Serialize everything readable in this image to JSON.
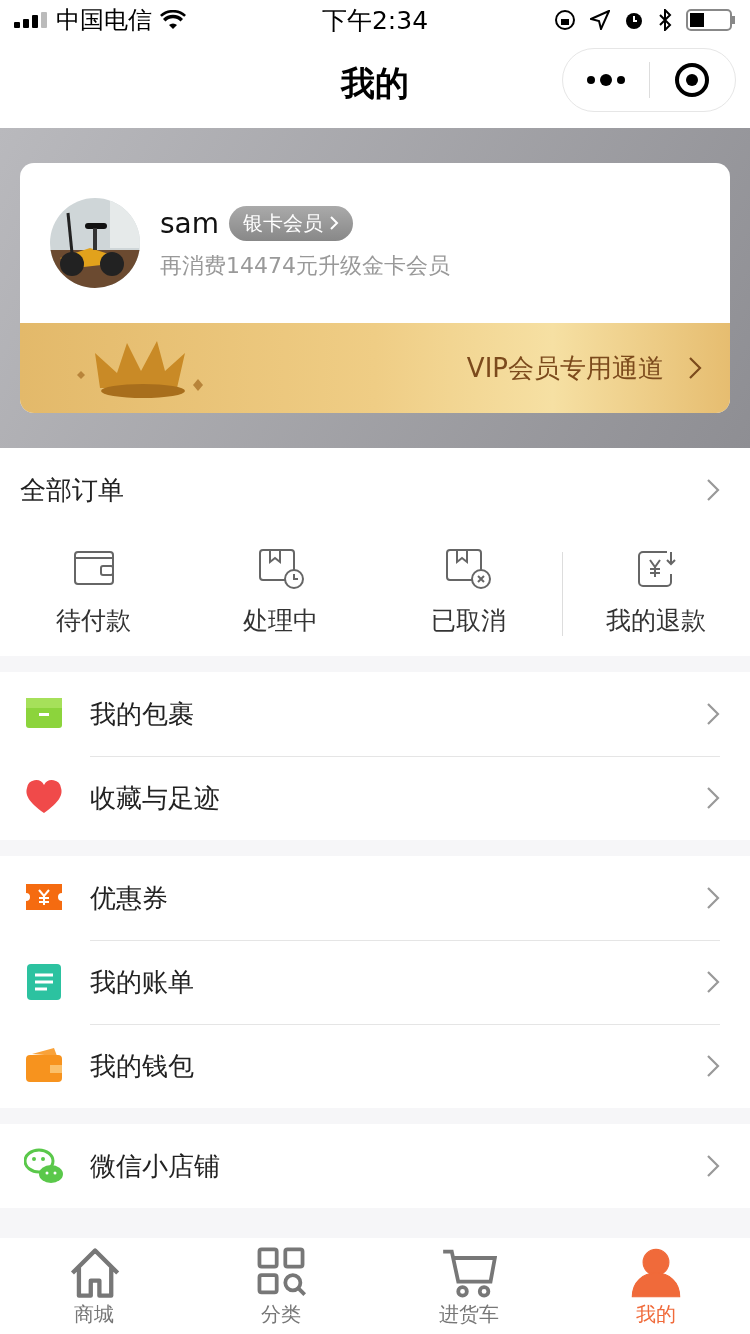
{
  "status_bar": {
    "carrier": "中国电信",
    "time": "下午2:34"
  },
  "nav": {
    "title": "我的"
  },
  "profile": {
    "name": "sam",
    "badge": "银卡会员",
    "subtitle": "再消费14474元升级金卡会员"
  },
  "vip_banner": {
    "label": "VIP会员专用通道"
  },
  "orders": {
    "title": "全部订单",
    "items": [
      {
        "label": "待付款",
        "kind": "wallet"
      },
      {
        "label": "处理中",
        "kind": "box-clock"
      },
      {
        "label": "已取消",
        "kind": "box-cancel"
      },
      {
        "label": "我的退款",
        "kind": "refund"
      }
    ]
  },
  "menu_groups": [
    [
      {
        "label": "我的包裹",
        "kind": "package"
      },
      {
        "label": "收藏与足迹",
        "kind": "heart"
      }
    ],
    [
      {
        "label": "优惠券",
        "kind": "coupon"
      },
      {
        "label": "我的账单",
        "kind": "bill"
      },
      {
        "label": "我的钱包",
        "kind": "wallet"
      }
    ],
    [
      {
        "label": "微信小店铺",
        "kind": "wechat"
      }
    ]
  ],
  "tab_bar": [
    {
      "label": "商城",
      "kind": "home",
      "selected": false
    },
    {
      "label": "分类",
      "kind": "category",
      "selected": false
    },
    {
      "label": "进货车",
      "kind": "cart",
      "selected": false
    },
    {
      "label": "我的",
      "kind": "user",
      "selected": true
    }
  ]
}
